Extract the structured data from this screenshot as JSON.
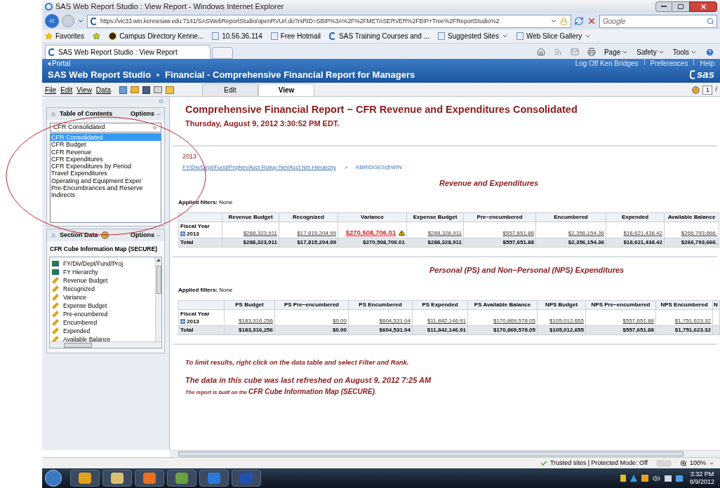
{
  "browser": {
    "title": "SAS Web Report Studio : View Report - Windows Internet Explorer",
    "url": "https://vic33.win.kennesaw.edu:7141/SASWebReportStudio/openRVUrl.do?rsRID=SBIP%3A%2F%2FMETASERVER%2FBIP+Tree%2FReportStudio%2",
    "search_placeholder": "Google",
    "favorites_label": "Favorites",
    "favorites": [
      {
        "label": "Campus Directory  Kenne...",
        "kind": "globe",
        "menu": false
      },
      {
        "label": "10.56.36.114",
        "kind": "ie",
        "menu": false
      },
      {
        "label": "Free Hotmail",
        "kind": "ie",
        "menu": false
      },
      {
        "label": "SAS Training Courses and ...",
        "kind": "sas",
        "menu": false
      },
      {
        "label": "Suggested Sites",
        "kind": "ie",
        "menu": true
      },
      {
        "label": "Web Slice Gallery",
        "kind": "ie",
        "menu": true
      }
    ],
    "tab": "SAS Web Report Studio : View Report",
    "commands": [
      "Page",
      "Safety",
      "Tools"
    ]
  },
  "app": {
    "portal": "Portal",
    "links": [
      "Log Off Ken Bridges",
      "Preferences",
      "Help"
    ],
    "product": "SAS Web Report Studio",
    "report_path": "Financial - Comprehensive Financial Report for Managers",
    "logo_text": "sas",
    "menu": [
      "File",
      "Edit",
      "View",
      "Data"
    ],
    "mode_tabs": [
      {
        "label": "Edit",
        "selected": false
      },
      {
        "label": "View",
        "selected": true
      }
    ],
    "page_field": "1",
    "page_total": "/"
  },
  "toc": {
    "title": "Table of Contents",
    "options": "Options",
    "dropdown_value": "CFR Consolidated",
    "items": [
      {
        "label": "CFR Consolidated",
        "selected": true
      },
      {
        "label": "CFR Budget",
        "selected": false
      },
      {
        "label": "CFR Revenue",
        "selected": false
      },
      {
        "label": "CFR Expenditures",
        "selected": false
      },
      {
        "label": "CFR Expenditures by Period",
        "selected": false
      },
      {
        "label": "Travel Expenditures",
        "selected": false
      },
      {
        "label": "Operating and Equipment Exper",
        "selected": false
      },
      {
        "label": "Pre-Encumbrances and Reserve",
        "selected": false
      },
      {
        "label": "Indirects",
        "selected": false
      }
    ]
  },
  "section_data": {
    "title": "Section Data",
    "options": "Options",
    "source": "CFR Cube Information Map (SECURE)",
    "items": [
      {
        "label": "FY/Div/Dept/Fund/Proj",
        "kind": "hierarchy"
      },
      {
        "label": "FY Hierarchy",
        "kind": "hierarchy"
      },
      {
        "label": "Revenue Budget",
        "kind": "measure"
      },
      {
        "label": "Recognized",
        "kind": "measure"
      },
      {
        "label": "Variance",
        "kind": "measure"
      },
      {
        "label": "Expense Budget",
        "kind": "measure"
      },
      {
        "label": "Pre-encumbered",
        "kind": "measure"
      },
      {
        "label": "Encumbered",
        "kind": "measure"
      },
      {
        "label": "Expended",
        "kind": "measure"
      },
      {
        "label": "Available Balance",
        "kind": "measure"
      }
    ]
  },
  "report": {
    "title": "Comprehensive Financial Report − CFR Revenue and Expenditures Consolidated",
    "date": "Thursday, August 9, 2012 3:30:52 PM EDT.",
    "year": "2013",
    "breadcrumb_link": "FY/Div/Dept/Fund/ProjNm/Acct Rollup Nm/Acct Nm Hierarchy",
    "breadcrumb_sep": ">",
    "breadcrumb_user": "KBRIDGES@WIN",
    "tables": [
      {
        "title": "Revenue and Expenditures",
        "filters_label": "Applied filters:",
        "filters_value": "None",
        "row_header": "Fiscal Year",
        "columns": [
          "Revenue Budget",
          "Recognized",
          "Variance",
          "Expense Budget",
          "Pre−encumbered",
          "Encumbered",
          "Expended",
          "Available Balance"
        ],
        "rows": [
          {
            "label": "2013",
            "kind": "detail",
            "cells": [
              {
                "v": "$288,323,911",
                "alert": false
              },
              {
                "v": "$17,815,204.99",
                "alert": false
              },
              {
                "v": "$270,508,706.01",
                "alert": true
              },
              {
                "v": "$288,328,911",
                "alert": false
              },
              {
                "v": "$557,651.88",
                "alert": false
              },
              {
                "v": "$2,356,154.36",
                "alert": false
              },
              {
                "v": "$18,621,438.42",
                "alert": false
              },
              {
                "v": "$266,793,666.",
                "alert": false
              }
            ]
          },
          {
            "label": "Total",
            "kind": "total",
            "cells": [
              "$288,323,911",
              "$17,815,204.99",
              "$270,508,706.01",
              "$288,328,911",
              "$557,651.88",
              "$2,356,154.36",
              "$18,621,438.42",
              "$266,793,666."
            ]
          }
        ]
      },
      {
        "title": "Personal (PS) and Non−Personal (NPS) Expenditures",
        "filters_label": "Applied filters:",
        "filters_value": "None",
        "row_header": "Fiscal Year",
        "columns": [
          "PS Budget",
          "PS Pre−encumbered",
          "PS Encumbered",
          "PS Expended",
          "PS Available Balance",
          "NPS Budget",
          "NPS Pre−encumbered",
          "NPS Encumbered",
          "N"
        ],
        "rows": [
          {
            "label": "2013",
            "kind": "detail",
            "cells": [
              {
                "v": "$183,316,256",
                "alert": false
              },
              {
                "v": "$0.00",
                "alert": false
              },
              {
                "v": "$604,531.04",
                "alert": false
              },
              {
                "v": "$11,842,146.91",
                "alert": false
              },
              {
                "v": "$170,869,578.05",
                "alert": false
              },
              {
                "v": "$105,012,655",
                "alert": false
              },
              {
                "v": "$557,651.88",
                "alert": false
              },
              {
                "v": "$1,751,623.32",
                "alert": false
              }
            ]
          },
          {
            "label": "Total",
            "kind": "total",
            "cells": [
              "$183,316,256",
              "$0.00",
              "$604,531.04",
              "$11,842,146.91",
              "$170,869,578.05",
              "$105,012,655",
              "$557,651.88",
              "$1,751,623.32"
            ]
          }
        ]
      }
    ],
    "hint": "To limit results, right click on the data table and select Filter and Rank.",
    "refreshed": "The data in this cube was last refreshed on August 9, 2012 7:25 AM",
    "built_on_prefix": "The report is built on the",
    "built_on_source": "CFR Cube Information Map (SECURE)",
    "built_on_suffix": "."
  },
  "status": {
    "zone": "Trusted sites | Protected Mode: Off",
    "zoom": "100%"
  },
  "taskbar": {
    "time": "3:32 PM",
    "date": "8/9/2012"
  }
}
